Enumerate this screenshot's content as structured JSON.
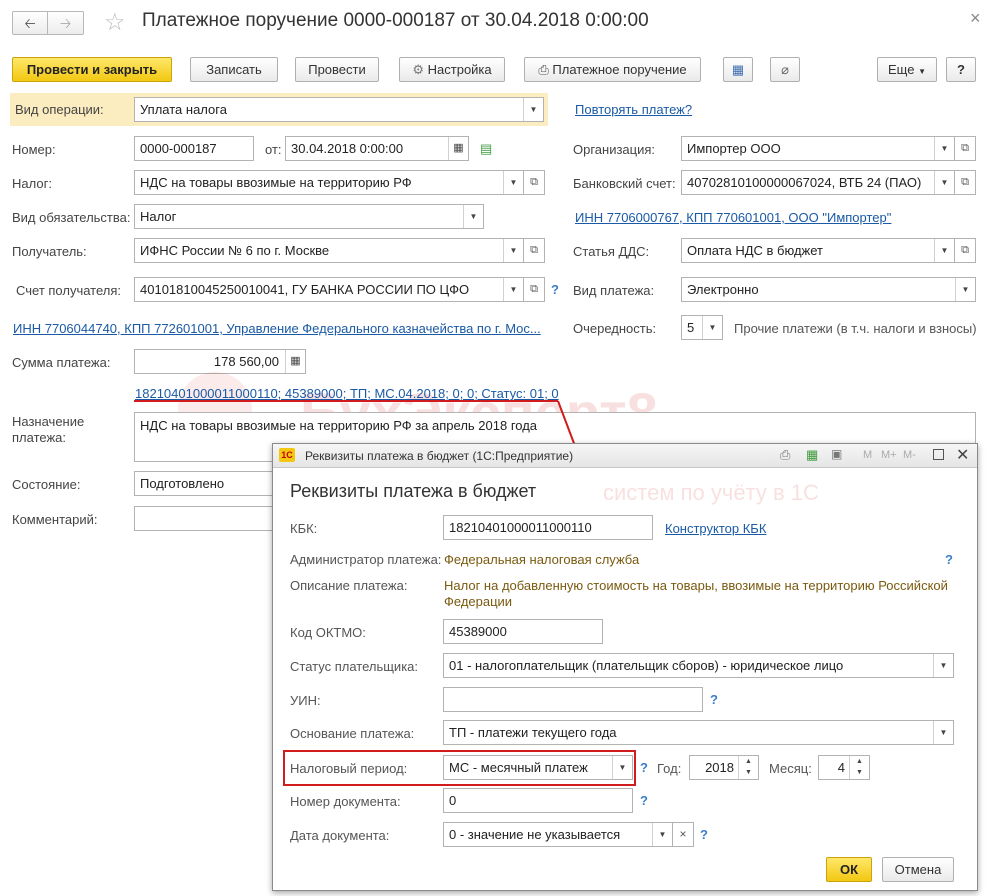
{
  "window": {
    "title": "Платежное поручение 0000-000187 от 30.04.2018 0:00:00",
    "close_glyph": "×"
  },
  "toolbar": {
    "post_close": "Провести и закрыть",
    "save": "Записать",
    "post": "Провести",
    "settings": "Настройка",
    "print": "Платежное поручение",
    "more": "Еще",
    "help": "?"
  },
  "form": {
    "operation": {
      "label": "Вид операции:",
      "value": "Уплата налога"
    },
    "repeat_link": "Повторять платеж?",
    "number": {
      "label": "Номер:",
      "value": "0000-000187"
    },
    "date": {
      "label": "от:",
      "value": "30.04.2018  0:00:00"
    },
    "organization": {
      "label": "Организация:",
      "value": "Импортер ООО"
    },
    "tax": {
      "label": "Налог:",
      "value": "НДС на товары ввозимые на территорию РФ"
    },
    "bank_account": {
      "label": "Банковский счет:",
      "value": "40702810100000067024, ВТБ 24 (ПАО)"
    },
    "obligation": {
      "label": "Вид обязательства:",
      "value": "Налог"
    },
    "payer_link": "ИНН 7706000767, КПП 770601001, ООО \"Импортер\"",
    "recipient": {
      "label": "Получатель:",
      "value": "ИФНС России № 6 по г. Москве"
    },
    "dds": {
      "label": "Статья ДДС:",
      "value": "Оплата НДС в бюджет"
    },
    "recipient_account": {
      "label": "Счет получателя:",
      "value": "40101810045250010041, ГУ БАНКА РОССИИ ПО ЦФО"
    },
    "payment_type": {
      "label": "Вид платежа:",
      "value": "Электронно"
    },
    "recipient_link": "ИНН 7706044740, КПП 772601001, Управление Федерального казначейства по г. Мос...",
    "priority": {
      "label": "Очередность:",
      "value": "5",
      "desc": "Прочие платежи (в т.ч. налоги и взносы)"
    },
    "amount": {
      "label": "Сумма платежа:",
      "value": "178 560,00"
    },
    "budget_link": "18210401000011000110; 45389000; ТП; МС.04.2018; 0; 0; Статус: 01; 0",
    "purpose": {
      "label": "Назначение платежа:",
      "value": "НДС на товары ввозимые на территорию РФ за апрель 2018 года"
    },
    "status": {
      "label": "Состояние:",
      "value": "Подготовлено"
    },
    "comment": {
      "label": "Комментарий:",
      "value": ""
    }
  },
  "watermark": {
    "line1": "БухЭксперт8",
    "line2": "систем по учёту в 1С"
  },
  "dialog": {
    "title": "Реквизиты платежа в бюджет  (1С:Предприятие)",
    "heading": "Реквизиты платежа в бюджет",
    "kbk": {
      "label": "КБК:",
      "value": "18210401000011000110",
      "link": "Конструктор КБК"
    },
    "admin": {
      "label": "Администратор платежа:",
      "value": "Федеральная налоговая служба"
    },
    "description": {
      "label": "Описание платежа:",
      "line1": "Налог на добавленную стоимость на товары, ввозимые на территорию Российской",
      "line2": "Федерации"
    },
    "oktmo": {
      "label": "Код ОКТМО:",
      "value": "45389000"
    },
    "payer_status": {
      "label": "Статус плательщика:",
      "value": "01 - налогоплательщик (плательщик сборов) - юридическое лицо"
    },
    "uin": {
      "label": "УИН:",
      "value": ""
    },
    "basis": {
      "label": "Основание платежа:",
      "value": "ТП - платежи текущего года"
    },
    "tax_period": {
      "label": "Налоговый период:",
      "value": "МС - месячный платеж"
    },
    "year": {
      "label": "Год:",
      "value": "2018"
    },
    "month": {
      "label": "Месяц:",
      "value": "4"
    },
    "doc_number": {
      "label": "Номер документа:",
      "value": "0"
    },
    "doc_date": {
      "label": "Дата документа:",
      "value": "0 - значение не указывается"
    },
    "ok": "ОК",
    "cancel": "Отмена",
    "title_tools": [
      "M",
      "M+",
      "M-"
    ]
  },
  "colors": {
    "accent_yellow": "#f2c811",
    "link_blue": "#1a5aa6",
    "highlight_red": "#d01c1c",
    "value_brown": "#7a5a0f"
  }
}
